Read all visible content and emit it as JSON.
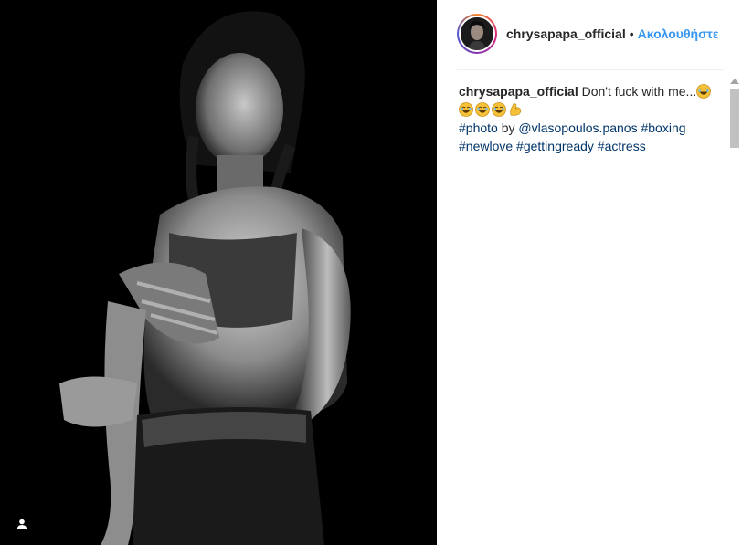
{
  "post": {
    "username": "chrysapapa_official",
    "separator": "•",
    "follow_label": "Ακολουθήστε",
    "caption": {
      "username": "chrysapapa_official",
      "text": "Don't fuck with me...",
      "emojis": [
        "laughing-emoji",
        "laughing-emoji",
        "laughing-emoji",
        "laughing-emoji",
        "flexed-biceps-emoji"
      ],
      "hashtag_photo": "#photo",
      "by_text": "by",
      "mention": "@vlasopoulos.panos",
      "hashtag_boxing": "#boxing",
      "hashtag_newlove": "#newlove",
      "hashtag_gettingready": "#gettingready",
      "hashtag_actress": "#actress"
    }
  },
  "icons": {
    "user_tag": "person-icon"
  },
  "colors": {
    "follow_blue": "#3897f0",
    "hashtag": "#003569",
    "photo_bg": "#000000"
  }
}
